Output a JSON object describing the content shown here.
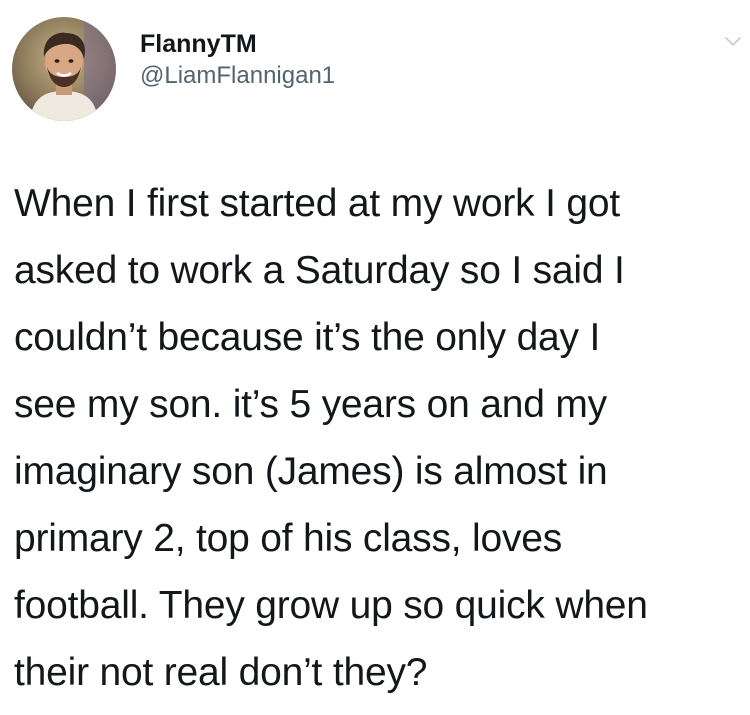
{
  "author": {
    "display_name": "FlannyTM",
    "handle": "@LiamFlannigan1"
  },
  "tweet": {
    "lines": [
      "When I first started at my work I got",
      "asked to work a Saturday so I said I",
      "couldn’t because it’s the only day I",
      "see my son. it’s 5 years on and my",
      "imaginary son (James) is almost in",
      "primary 2, top of his class, loves",
      "football. They grow up so quick when",
      "their not real don’t they?"
    ]
  },
  "icons": {
    "menu": "chevron-down-icon"
  }
}
